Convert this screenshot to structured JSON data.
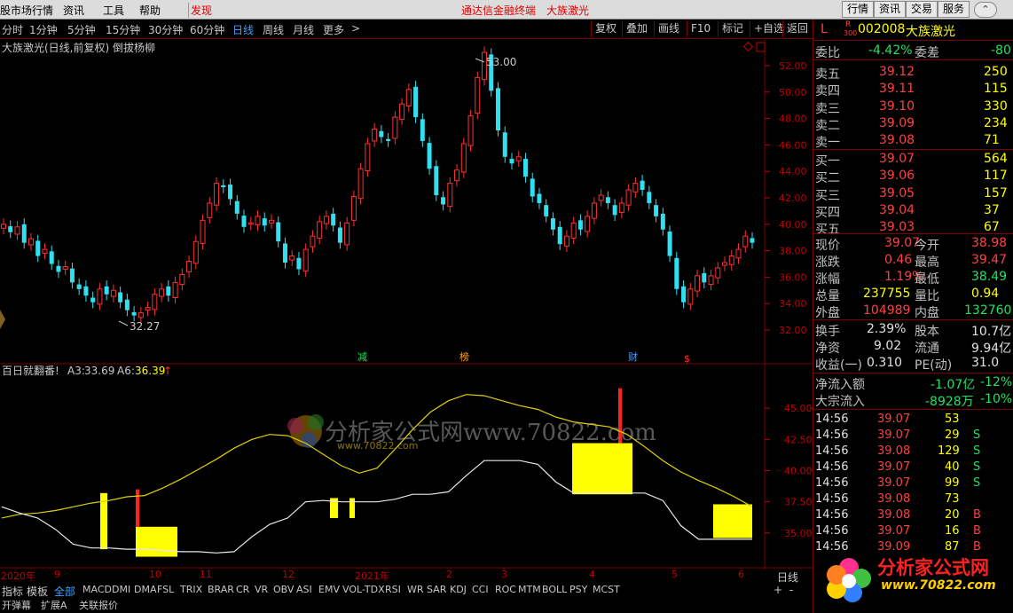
{
  "menu": {
    "items": [
      "股市场行情",
      "资讯",
      "工具",
      "帮助"
    ],
    "discover": "发现",
    "center_title": "通达信金融终端",
    "center_stock": "大族激光",
    "right_buttons": [
      "行情",
      "资讯",
      "交易",
      "服务"
    ]
  },
  "periods": {
    "items": [
      "分时",
      "1分钟",
      "5分钟",
      "15分钟",
      "30分钟",
      "60分钟",
      "日线",
      "周线",
      "月线",
      "更多"
    ],
    "selected": "日线",
    "more_arrow": ">",
    "tools": [
      "复权",
      "叠加",
      "画线",
      "F10",
      "标记",
      "+自选",
      "返回"
    ]
  },
  "main_chart": {
    "title": "大族激光(日线,前复权) 倒拔杨柳",
    "y_axis": [
      "52.00",
      "50.00",
      "48.00",
      "46.00",
      "44.00",
      "42.00",
      "40.00",
      "38.00",
      "36.00",
      "34.00",
      "32.00"
    ],
    "high_label": "53.00",
    "low_label": "32.27",
    "markers": [
      {
        "text": "减",
        "color": "#20e060"
      },
      {
        "text": "榜",
        "color": "#ffa000"
      },
      {
        "text": "财",
        "color": "#40a0ff"
      },
      {
        "text": "$",
        "color": "#ff3030"
      }
    ]
  },
  "indicator": {
    "name": "百日就翻番!",
    "a3_label": "A3:",
    "a3_value": "33.69",
    "a6_label": "A6:",
    "a6_value": "36.39",
    "arrow": "↑",
    "y_axis": [
      "45.00",
      "42.50",
      "40.00",
      "37.50",
      "35.00"
    ],
    "watermark": "分析家公式网www.70822.com",
    "watermark_small": "www.70822.com"
  },
  "chart_data": {
    "type": "candlestick",
    "title": "大族激光(日线,前复权) 倒拔杨柳",
    "ylim": [
      31,
      53.5
    ],
    "high": 53.0,
    "low": 32.27,
    "close": [
      40,
      39.4,
      39.8,
      38.6,
      38.9,
      37.6,
      38.1,
      37,
      36.4,
      36.8,
      35.6,
      35.1,
      34.6,
      34.1,
      35.1,
      34.7,
      35,
      34.1,
      33.5,
      33.1,
      33.3,
      33.7,
      34.7,
      35.1,
      34.6,
      35.6,
      36.2,
      37.2,
      38.7,
      40.3,
      41.6,
      43.1,
      42.8,
      41.9,
      40.8,
      39.8,
      40.1,
      40.6,
      39.9,
      40.3,
      38.7,
      37.1,
      37.6,
      36.6,
      38.1,
      39.1,
      40.2,
      40.6,
      39.9,
      38.6,
      40.1,
      42.1,
      44.2,
      46.1,
      47.2,
      46.6,
      46.3,
      48.1,
      49.1,
      50.2,
      48.1,
      46.3,
      44.2,
      42.2,
      41.5,
      43.1,
      44.1,
      46.1,
      48.2,
      51.1,
      53,
      50.1,
      47.1,
      45.1,
      44.6,
      45.1,
      43.6,
      42.1,
      41.6,
      40.6,
      39.6,
      38.5,
      39.1,
      40.1,
      39.6,
      40.6,
      41.6,
      42.2,
      41.6,
      40.7,
      41.6,
      42.6,
      43.1,
      42.6,
      41.6,
      40.6,
      39.6,
      37.6,
      35.1,
      34.1,
      35.1,
      36.1,
      35.6,
      36.1,
      36.7,
      37.1,
      37.6,
      38.1,
      39.1,
      38.6
    ],
    "indicator_series": {
      "yellow_line": [
        36.2,
        36.5,
        36.6,
        36.8,
        37.1,
        37.4,
        37.6,
        37.9,
        38,
        38.6,
        39.3,
        40.1,
        40.9,
        41.8,
        42.5,
        42.9,
        42.8,
        42.2,
        41.3,
        40.4,
        39.8,
        40.2,
        41.7,
        43.3,
        44.7,
        45.6,
        46.1,
        46,
        45.6,
        45.2,
        44.9,
        44.3,
        43.9,
        43.7,
        43.5,
        42.9,
        41.9,
        40.8,
        39.9,
        39.2,
        38.6,
        37.9,
        37.1
      ],
      "white_line": [
        37.1,
        36.6,
        36.2,
        35.3,
        34.1,
        33.8,
        33.8,
        33.7,
        33.7,
        33.6,
        33.5,
        33.5,
        33.4,
        33.5,
        34.7,
        35.7,
        36.2,
        37.5,
        37.6,
        37.5,
        37.5,
        37.5,
        37.7,
        38.1,
        38.1,
        38.3,
        39.6,
        40.8,
        40.8,
        40.8,
        40.5,
        39.1,
        38.2,
        38.2,
        38.2,
        38.2,
        38.2,
        37.6,
        35.6,
        34.5,
        34.5,
        34.5,
        34.5
      ]
    }
  },
  "bottom": {
    "x_axis": [
      "2020年",
      "9",
      "10",
      "11",
      "12",
      "2021年",
      "2",
      "3",
      "4",
      "5",
      "6"
    ],
    "period_label": "日线",
    "plus": "+",
    "minus": "-",
    "tabs": [
      "指标",
      "模板",
      "全部",
      "MACD",
      "DMI",
      "DMA",
      "FSL",
      "TRIX",
      "BRAR",
      "CR",
      "VR",
      "OBV",
      "ASI",
      "EMV",
      "VOL-TDX",
      "RSI",
      "WR",
      "SAR",
      "KDJ",
      "CCI",
      "ROC",
      "MTM",
      "BOLL",
      "PSY",
      "MCST"
    ],
    "selected_tab": "全部",
    "cut_labels": [
      "开弹幕",
      "扩展A",
      "关联报价"
    ]
  },
  "quote": {
    "code": "002008",
    "name": "大族激光",
    "badge_l": "L",
    "badge_r": "R",
    "badge_300": "300",
    "weibi_label": "委比",
    "weibi": "-4.42%",
    "weicha_label": "委差",
    "weicha": "-80",
    "asks": [
      {
        "label": "卖五",
        "price": "39.12",
        "vol": "250"
      },
      {
        "label": "卖四",
        "price": "39.11",
        "vol": "115"
      },
      {
        "label": "卖三",
        "price": "39.10",
        "vol": "330"
      },
      {
        "label": "卖二",
        "price": "39.09",
        "vol": "234"
      },
      {
        "label": "卖一",
        "price": "39.08",
        "vol": "71"
      }
    ],
    "bids": [
      {
        "label": "买一",
        "price": "39.07",
        "vol": "564"
      },
      {
        "label": "买二",
        "price": "39.06",
        "vol": "117"
      },
      {
        "label": "买三",
        "price": "39.05",
        "vol": "157"
      },
      {
        "label": "买四",
        "price": "39.04",
        "vol": "37"
      },
      {
        "label": "买五",
        "price": "39.03",
        "vol": "67"
      }
    ],
    "stats": [
      {
        "l1": "现价",
        "v1": "39.07",
        "c1": "up",
        "l2": "今开",
        "v2": "38.98",
        "c2": "up"
      },
      {
        "l1": "涨跌",
        "v1": "0.46",
        "c1": "up",
        "l2": "最高",
        "v2": "39.47",
        "c2": "up"
      },
      {
        "l1": "涨幅",
        "v1": "1.19%",
        "c1": "up",
        "l2": "最低",
        "v2": "38.49",
        "c2": "dn"
      },
      {
        "l1": "总量",
        "v1": "237755",
        "c1": "yl",
        "l2": "量比",
        "v2": "0.94",
        "c2": "yl"
      },
      {
        "l1": "外盘",
        "v1": "104989",
        "c1": "up",
        "l2": "内盘",
        "v2": "132760",
        "c2": "dn"
      }
    ],
    "stats2": [
      {
        "l1": "换手",
        "v1": "2.39%",
        "l2": "股本",
        "v2": "10.7亿"
      },
      {
        "l1": "净资",
        "v1": "9.02",
        "l2": "流通",
        "v2": "9.94亿"
      },
      {
        "l1": "收益(一)",
        "v1": "0.310",
        "l2": "PE(动)",
        "v2": "31.0"
      }
    ],
    "flow": [
      {
        "label": "净流入额",
        "v1": "-1.07亿",
        "v2": "-12%"
      },
      {
        "label": "大宗流入",
        "v1": "-8928万",
        "v2": "-10%"
      }
    ],
    "ticks": [
      {
        "time": "14:56",
        "price": "39.07",
        "pc": "up",
        "vol": "53",
        "flag": ""
      },
      {
        "time": "14:56",
        "price": "39.07",
        "pc": "up",
        "vol": "29",
        "flag": "S"
      },
      {
        "time": "14:56",
        "price": "39.08",
        "pc": "up",
        "vol": "129",
        "flag": "S"
      },
      {
        "time": "14:56",
        "price": "39.07",
        "pc": "up",
        "vol": "40",
        "flag": "S"
      },
      {
        "time": "14:56",
        "price": "39.07",
        "pc": "up",
        "vol": "99",
        "flag": "S"
      },
      {
        "time": "14:56",
        "price": "39.08",
        "pc": "up",
        "vol": "73",
        "flag": ""
      },
      {
        "time": "14:56",
        "price": "39.08",
        "pc": "up",
        "vol": "20",
        "flag": "B"
      },
      {
        "time": "14:56",
        "price": "39.07",
        "pc": "up",
        "vol": "16",
        "flag": "B"
      },
      {
        "time": "14:56",
        "price": "39.09",
        "pc": "up",
        "vol": "87",
        "flag": "B"
      }
    ],
    "logo_text": "分析家公式网",
    "logo_url": "www.70822.com"
  }
}
